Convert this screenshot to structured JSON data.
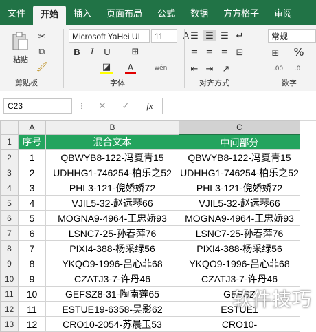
{
  "tabs": [
    "文件",
    "开始",
    "插入",
    "页面布局",
    "公式",
    "数据",
    "方方格子",
    "审阅"
  ],
  "active_tab": "开始",
  "clipboard": {
    "paste_label": "粘贴",
    "group_label": "剪贴板"
  },
  "font": {
    "name": "Microsoft YaHei UI",
    "size": "11",
    "group_label": "字体",
    "bold": "B",
    "italic": "I",
    "underline": "U",
    "grow": "A",
    "shrink": "A",
    "font_color": "A",
    "phonetic": "wén"
  },
  "alignment": {
    "group_label": "对齐方式"
  },
  "number": {
    "format": "常规",
    "percent": "%",
    "group_label": "数字"
  },
  "formula_bar": {
    "name_box": "C23",
    "fx": "fx",
    "cancel": "✕",
    "enter": "✓"
  },
  "sheet": {
    "columns": [
      "A",
      "B",
      "C"
    ],
    "rows": [
      {
        "n": "1",
        "a": "序号",
        "b": "混合文本",
        "c": "中间部分"
      },
      {
        "n": "2",
        "a": "1",
        "b": "QBWYB8-122-冯夏青15",
        "c": "QBWYB8-122-冯夏青15"
      },
      {
        "n": "3",
        "a": "2",
        "b": "UDHHG1-746254-柏乐之52",
        "c": "UDHHG1-746254-柏乐之52"
      },
      {
        "n": "4",
        "a": "3",
        "b": "PHL3-121-倪娇娇72",
        "c": "PHL3-121-倪娇娇72"
      },
      {
        "n": "5",
        "a": "4",
        "b": "VJIL5-32-赵远琴66",
        "c": "VJIL5-32-赵远琴66"
      },
      {
        "n": "6",
        "a": "5",
        "b": "MOGNA9-4964-王忠娇93",
        "c": "MOGNA9-4964-王忠娇93"
      },
      {
        "n": "7",
        "a": "6",
        "b": "LSNC7-25-孙春萍76",
        "c": "LSNC7-25-孙春萍76"
      },
      {
        "n": "8",
        "a": "7",
        "b": "PIXI4-388-杨采绿56",
        "c": "PIXI4-388-杨采绿56"
      },
      {
        "n": "9",
        "a": "8",
        "b": "YKQO9-1996-吕心菲68",
        "c": "YKQO9-1996-吕心菲68"
      },
      {
        "n": "10",
        "a": "9",
        "b": "CZATJ3-7-许丹46",
        "c": "CZATJ3-7-许丹46"
      },
      {
        "n": "11",
        "a": "10",
        "b": "GEFSZ8-31-陶南莲65",
        "c": "GEFSZ"
      },
      {
        "n": "12",
        "a": "11",
        "b": "ESTUE19-6358-吴影62",
        "c": "ESTUE1"
      },
      {
        "n": "13",
        "a": "12",
        "b": "CRO10-2054-苏晨玉53",
        "c": "CRO10-"
      }
    ]
  },
  "watermark": "软件技巧",
  "colors": {
    "accent": "#217346",
    "header_fill": "#23a45e"
  }
}
